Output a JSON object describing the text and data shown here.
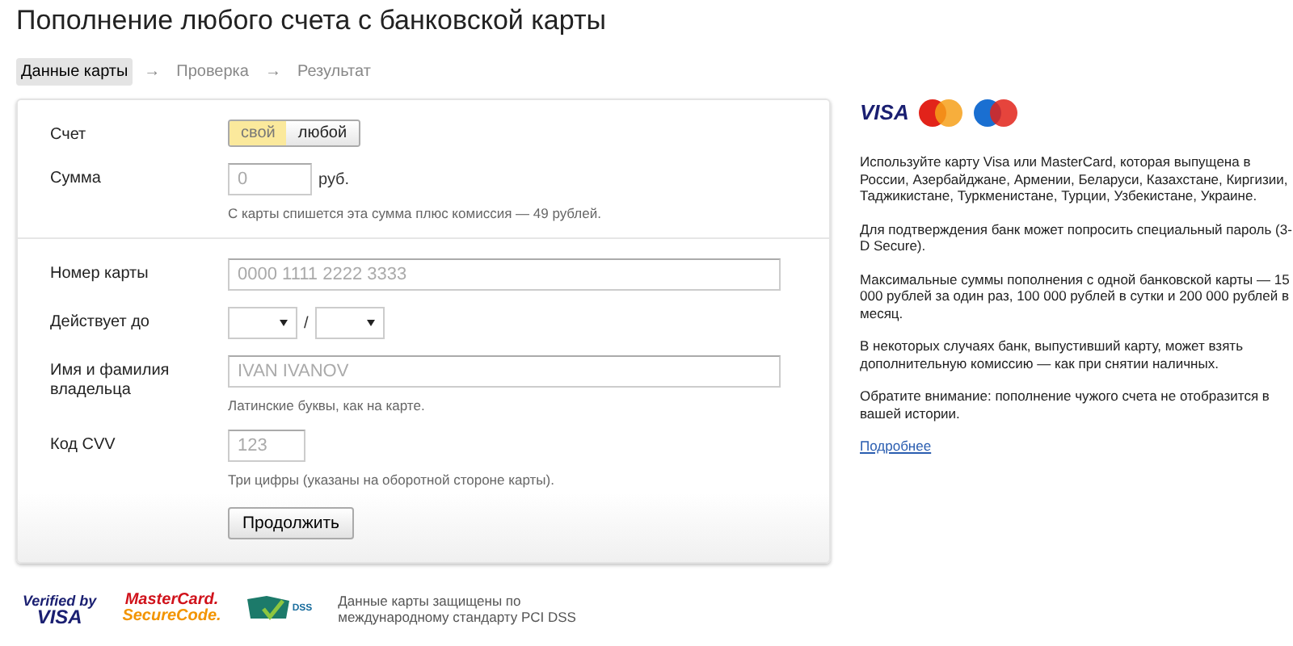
{
  "title": "Пополнение любого счета с банковской карты",
  "steps": [
    {
      "label": "Данные карты",
      "selected": true
    },
    {
      "label": "Проверка",
      "selected": false
    },
    {
      "label": "Результат",
      "selected": false
    }
  ],
  "step_separator": "→",
  "form": {
    "sections": [
      {
        "rows": [
          {
            "kind": "toggle",
            "label": "Счет",
            "options": [
              {
                "label": "свой",
                "selected": true
              },
              {
                "label": "любой",
                "selected": false
              }
            ]
          },
          {
            "kind": "amount",
            "label": "Сумма",
            "placeholder": "0",
            "unit": "руб.",
            "hint": "С карты спишется эта сумма плюс комиссия — 49 рублей."
          }
        ]
      },
      {
        "rows": [
          {
            "kind": "wide",
            "label": "Номер карты",
            "placeholder": "0000 1111 2222 3333"
          },
          {
            "kind": "expiry",
            "label": "Действует до",
            "separator": "/"
          },
          {
            "kind": "wide",
            "label": "Имя и фамилия владельца",
            "placeholder": "IVAN IVANOV",
            "hint": "Латинские буквы, как на карте."
          },
          {
            "kind": "short",
            "label": "Код CVV",
            "placeholder": "123",
            "hint": "Три цифры (указаны на оборотной стороне карты)."
          }
        ]
      }
    ],
    "submit": "Продолжить"
  },
  "sidebar": {
    "visa_logo": "VISA",
    "paragraphs": [
      "Используйте карту Visa или MasterCard, которая выпущена в России, Азербайджане, Армении, Беларуси, Казахстане, Киргизии, Таджикистане, Туркменистане, Турции, Узбекистане, Украине.",
      "Для подтверждения банк может попросить специальный пароль (3-D Secure).",
      "Максимальные суммы пополнения с одной банковской карты — 15 000 рублей за один раз, 100 000 рублей в сутки и 200 000 рублей в месяц.",
      "В некоторых случаях банк, выпустивший карту, может взять дополнительную комиссию — как при снятии наличных.",
      "Обратите внимание: пополнение чужого счета не отобразится в вашей истории."
    ],
    "link": "Подробнее"
  },
  "footer": {
    "verified_top": "Verified by",
    "verified_bottom": "VISA",
    "securecode_top": "MasterCard.",
    "securecode_bottom": "SecureCode.",
    "pci_mark": "DSS",
    "security_note": "Данные карты защищены по международному стандарту PCI DSS"
  }
}
